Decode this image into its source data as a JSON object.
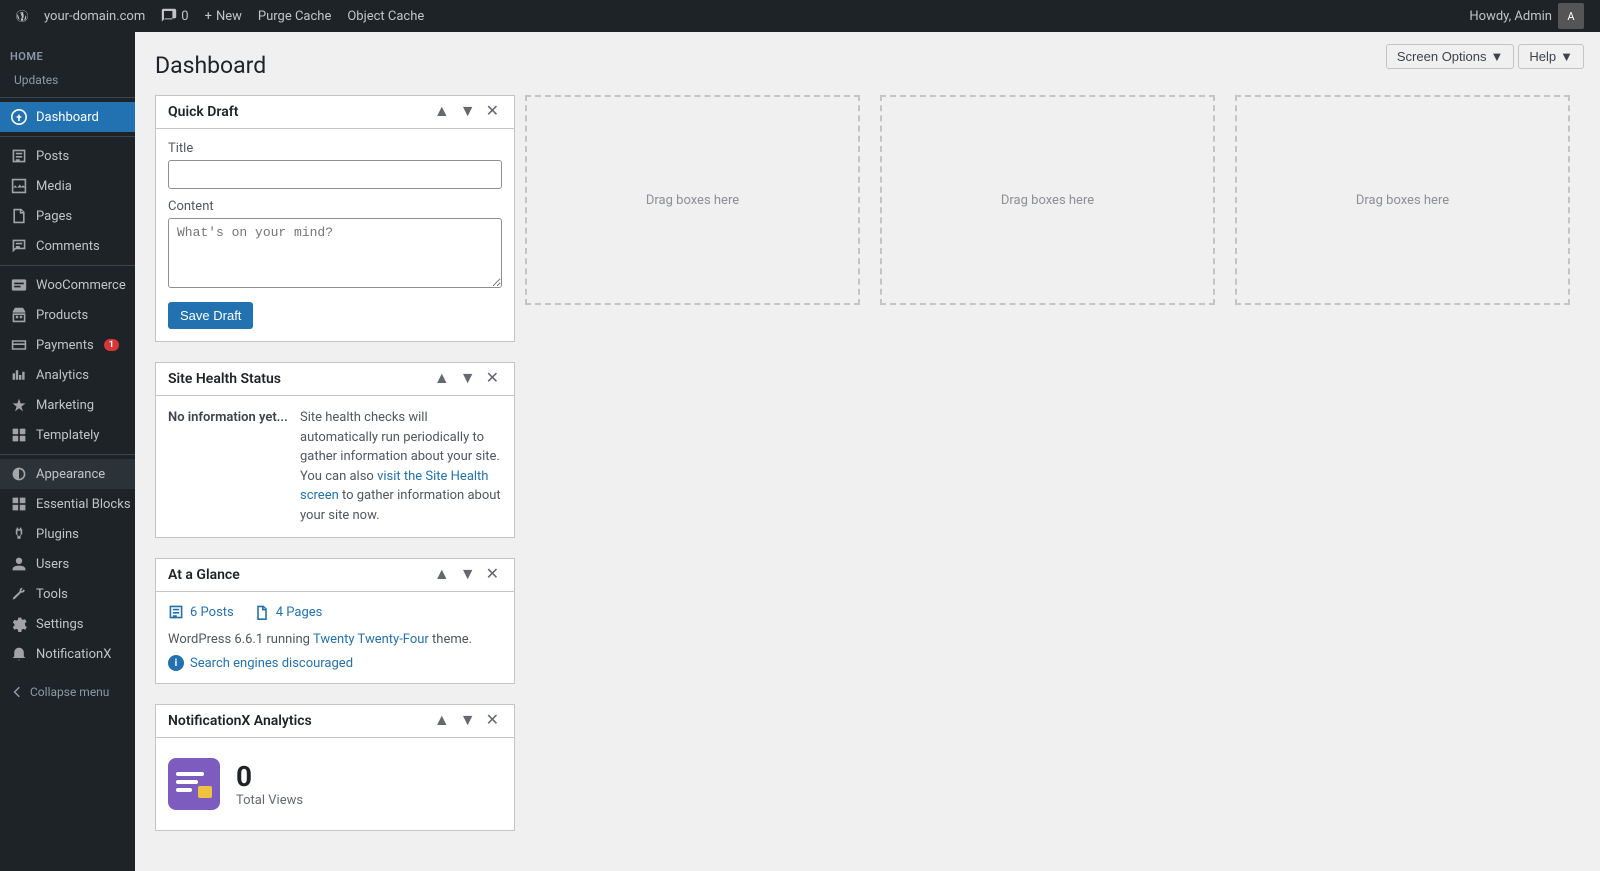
{
  "adminbar": {
    "logo_alt": "WordPress",
    "site_name": "your-domain.com",
    "comments_count": "0",
    "new_label": "New",
    "purge_cache": "Purge Cache",
    "object_cache": "Object Cache",
    "howdy": "Howdy, Admin"
  },
  "sidebar": {
    "home_section": "Home",
    "updates_label": "Updates",
    "items": [
      {
        "id": "dashboard",
        "label": "Dashboard",
        "icon": "dashboard"
      },
      {
        "id": "posts",
        "label": "Posts",
        "icon": "posts"
      },
      {
        "id": "media",
        "label": "Media",
        "icon": "media"
      },
      {
        "id": "pages",
        "label": "Pages",
        "icon": "pages"
      },
      {
        "id": "comments",
        "label": "Comments",
        "icon": "comments"
      },
      {
        "id": "woocommerce",
        "label": "WooCommerce",
        "icon": "woo"
      },
      {
        "id": "products",
        "label": "Products",
        "icon": "products"
      },
      {
        "id": "payments",
        "label": "Payments",
        "icon": "payments",
        "badge": "1"
      },
      {
        "id": "analytics",
        "label": "Analytics",
        "icon": "analytics"
      },
      {
        "id": "marketing",
        "label": "Marketing",
        "icon": "marketing"
      },
      {
        "id": "templately",
        "label": "Templately",
        "icon": "templately"
      },
      {
        "id": "appearance",
        "label": "Appearance",
        "icon": "appearance"
      },
      {
        "id": "essential-blocks",
        "label": "Essential Blocks",
        "icon": "blocks"
      },
      {
        "id": "plugins",
        "label": "Plugins",
        "icon": "plugins"
      },
      {
        "id": "users",
        "label": "Users",
        "icon": "users"
      },
      {
        "id": "tools",
        "label": "Tools",
        "icon": "tools"
      },
      {
        "id": "settings",
        "label": "Settings",
        "icon": "settings"
      },
      {
        "id": "notificationx",
        "label": "NotificationX",
        "icon": "notifx"
      }
    ],
    "collapse_label": "Collapse menu"
  },
  "header": {
    "title": "Dashboard",
    "screen_options": "Screen Options",
    "help": "Help"
  },
  "quick_draft": {
    "title": "Quick Draft",
    "title_label": "Title",
    "title_placeholder": "",
    "content_label": "Content",
    "content_placeholder": "What's on your mind?",
    "save_label": "Save Draft"
  },
  "drag_zones": [
    {
      "label": "Drag boxes here"
    },
    {
      "label": "Drag boxes here"
    },
    {
      "label": "Drag boxes here"
    }
  ],
  "site_health": {
    "title": "Site Health Status",
    "no_info": "No information yet...",
    "description": "Site health checks will automatically run periodically to gather information about your site. You can also ",
    "link1_text": "visit the Site Health screen",
    "link1_href": "#",
    "link2_text": " to gather information about your site now.",
    "link2_href": "#"
  },
  "at_a_glance": {
    "title": "At a Glance",
    "posts_count": "6 Posts",
    "pages_count": "4 Pages",
    "wp_info": "WordPress 6.6.1 running ",
    "theme_link": "Twenty Twenty-Four",
    "theme_suffix": " theme.",
    "warning_link": "Search engines discouraged"
  },
  "notificationx": {
    "title": "NotificationX Analytics",
    "total_views_count": "0",
    "total_views_label": "Total Views"
  }
}
